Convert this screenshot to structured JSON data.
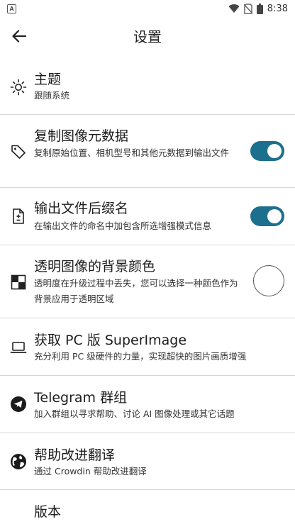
{
  "status_bar": {
    "time": "8:38",
    "app_icon": "A"
  },
  "header": {
    "title": "设置"
  },
  "settings": [
    {
      "title": "主题",
      "subtitle": "跟随系统",
      "icon": "sun-icon"
    },
    {
      "title": "复制图像元数据",
      "subtitle": "复制原始位置、相机型号和其他元数据到输出文件",
      "icon": "tag-icon",
      "toggle_on": true
    },
    {
      "title": "输出文件后缀名",
      "subtitle": "在输出文件的命名中加包含所选增强模式信息",
      "icon": "file-plus-minus-icon",
      "toggle_on": true
    },
    {
      "title": "透明图像的背景颜色",
      "subtitle": "透明度在升级过程中丢失，您可以选择一种颜色作为背景应用于透明区域",
      "icon": "checkerboard-icon",
      "color": "#ffffff"
    },
    {
      "title": "获取 PC 版 SuperImage",
      "subtitle": "充分利用 PC 级硬件的力量，实现超快的图片画质增强",
      "icon": "laptop-icon"
    },
    {
      "title": "Telegram 群组",
      "subtitle": "加入群组以寻求帮助、讨论 AI 图像处理或其它话题",
      "icon": "telegram-icon"
    },
    {
      "title": "帮助改进翻译",
      "subtitle": "通过 Crowdin 帮助改进翻译",
      "icon": "globe-icon"
    },
    {
      "title": "版本"
    }
  ],
  "colors": {
    "accent": "#1d6f8e",
    "divider": "#d6d6d6"
  }
}
